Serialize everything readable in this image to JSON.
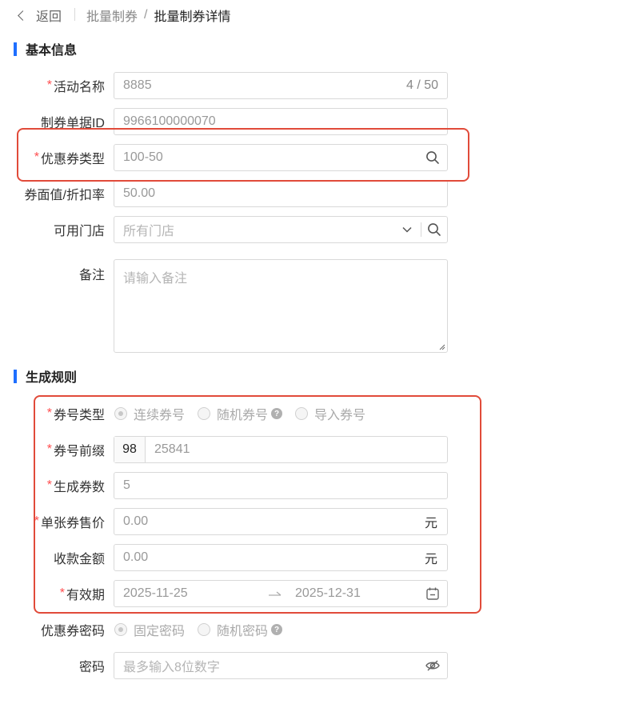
{
  "header": {
    "back_label": "返回",
    "crumb_parent": "批量制券",
    "crumb_sep": "/",
    "crumb_current": "批量制券详情"
  },
  "sections": {
    "basic": "基本信息",
    "rules": "生成规则"
  },
  "form": {
    "required_mark": "*",
    "activity_name": {
      "label": "活动名称",
      "value": "8885",
      "count": "4 / 50"
    },
    "voucher_id": {
      "label": "制券单据ID",
      "value": "9966100000070"
    },
    "coupon_type": {
      "label": "优惠券类型",
      "value": "100-50"
    },
    "face_value": {
      "label": "券面值/折扣率",
      "value": "50.00"
    },
    "stores": {
      "label": "可用门店",
      "placeholder": "所有门店"
    },
    "remark": {
      "label": "备注",
      "placeholder": "请输入备注"
    },
    "code_type": {
      "label": "券号类型",
      "options": [
        "连续券号",
        "随机券号",
        "导入券号"
      ],
      "selected": "连续券号"
    },
    "code_prefix": {
      "label": "券号前缀",
      "prefix": "98",
      "value": "25841"
    },
    "count": {
      "label": "生成券数",
      "value": "5"
    },
    "unit_price": {
      "label": "单张券售价",
      "value": "0.00",
      "unit": "元"
    },
    "amount": {
      "label": "收款金额",
      "value": "0.00",
      "unit": "元"
    },
    "validity": {
      "label": "有效期",
      "start": "2025-11-25",
      "end": "2025-12-31"
    },
    "coupon_pwd": {
      "label": "优惠券密码",
      "options": [
        "固定密码",
        "随机密码"
      ],
      "selected": "固定密码"
    },
    "password": {
      "label": "密码",
      "placeholder": "最多输入8位数字"
    }
  },
  "icons": {
    "search": "search-icon",
    "chevron": "chevron-down-icon",
    "calendar": "calendar-icon",
    "eye_off": "eye-off-icon",
    "help": "help-icon"
  },
  "colors": {
    "accent": "#1f6fff",
    "required": "#ff4d4f",
    "highlight": "#e14b3a"
  }
}
